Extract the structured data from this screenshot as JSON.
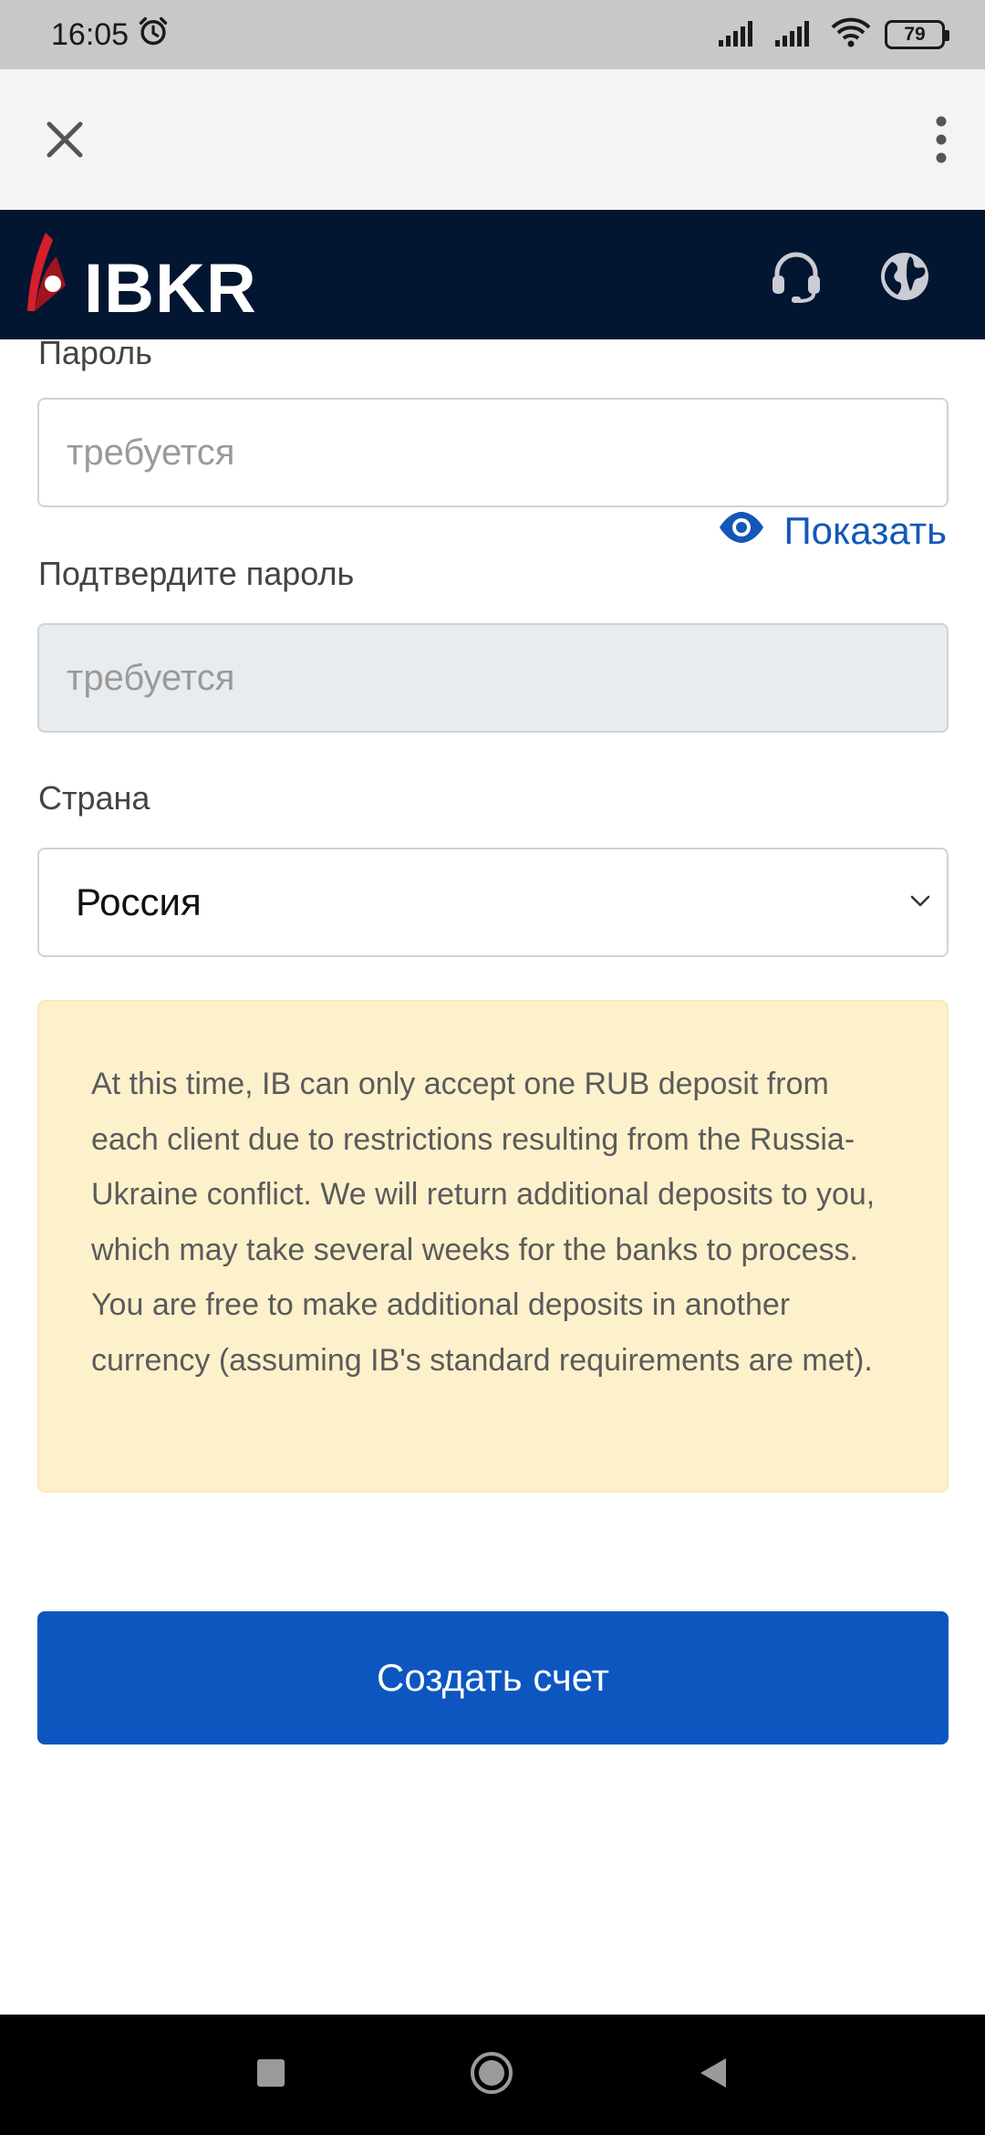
{
  "status_bar": {
    "time": "16:05",
    "battery": "79",
    "icons": [
      "alarm-icon",
      "signal-icon",
      "signal-icon",
      "wifi-icon",
      "battery-icon"
    ]
  },
  "browser": {
    "close_icon": "close-icon",
    "menu_icon": "more-vert-icon"
  },
  "header": {
    "brand": "IBKR",
    "icons": [
      "headset-icon",
      "globe-icon"
    ]
  },
  "form": {
    "password_label": "Пароль",
    "password_placeholder": "требуется",
    "show_label": "Показать",
    "confirm_label": "Подтвердите пароль",
    "confirm_placeholder": "требуется",
    "country_label": "Страна",
    "country_value": "Россия",
    "notice": "At this time, IB can only accept one RUB deposit from each client due to restrictions resulting from the Russia-Ukraine conflict. We will return additional deposits to you, which may take several weeks for the banks to process. You are free to make additional deposits in another currency (assuming IB's standard requirements are met).",
    "submit_label": "Создать счет"
  },
  "colors": {
    "header_bg": "#021631",
    "accent": "#0d56c0",
    "notice_bg": "#fdf1cc"
  }
}
